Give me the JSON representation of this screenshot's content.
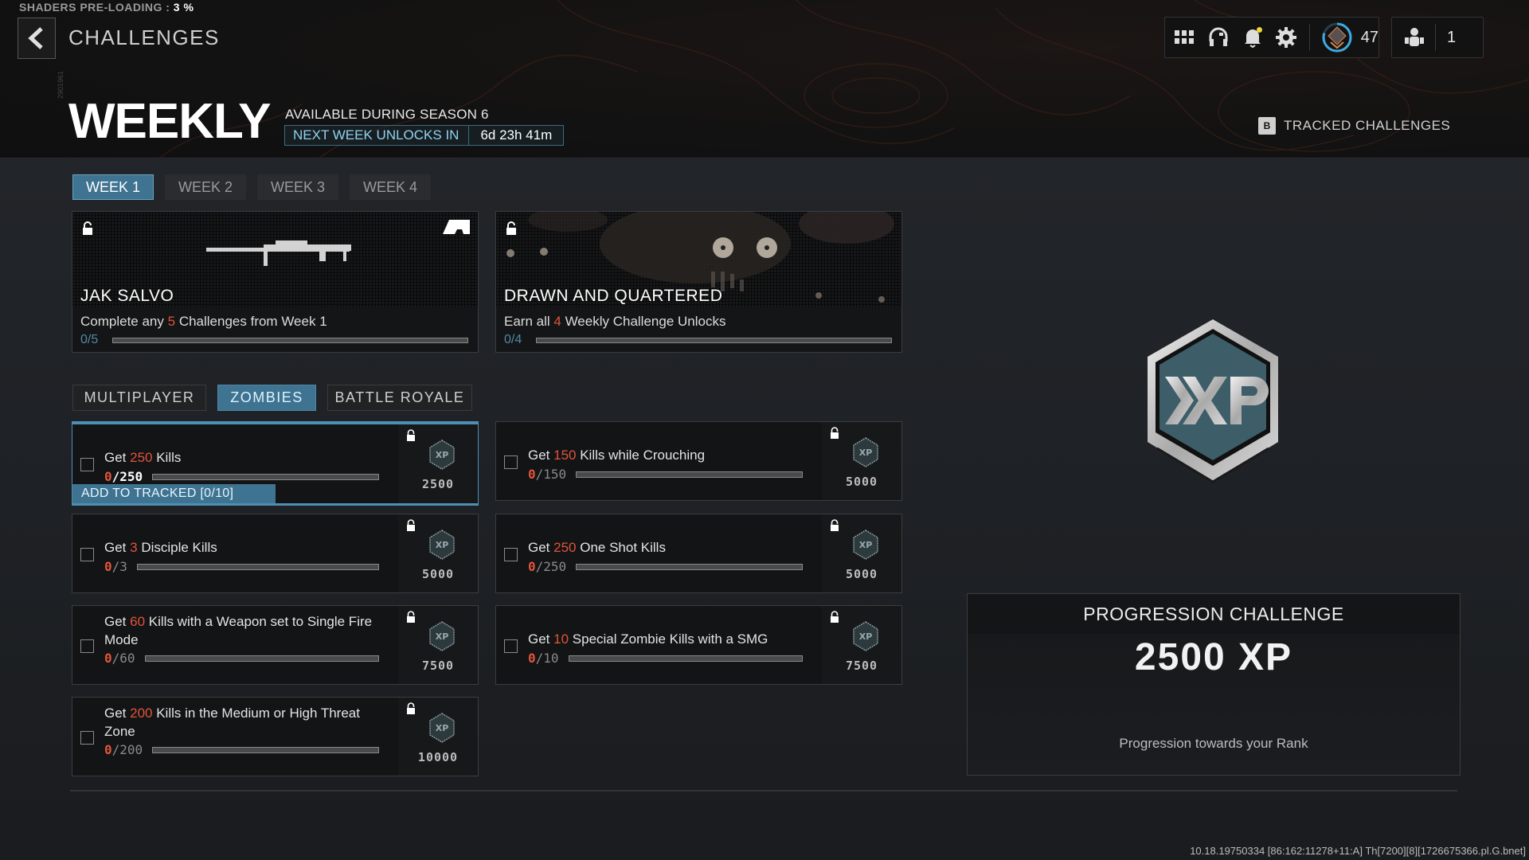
{
  "shaders": {
    "label": "SHADERS PRE-LOADING :",
    "value": "3 %"
  },
  "header": {
    "breadcrumb": "CHALLENGES",
    "title": "WEEKLY",
    "vertical_id": "2901961",
    "season": "AVAILABLE DURING SEASON 6",
    "unlock_label": "NEXT WEEK UNLOCKS IN",
    "unlock_time": "6d 23h 41m",
    "tracked_key": "B",
    "tracked_label": "TRACKED CHALLENGES"
  },
  "top_bar": {
    "icons": [
      "grid-menu-icon",
      "headset-icon",
      "notification-bell-icon",
      "settings-gear-icon",
      "rank-emblem-icon"
    ],
    "notification_dot_color": "#f0d53a",
    "rank_level": "47",
    "rank_progress": 0.8,
    "party_icon": "party-members-icon",
    "party_count": "1"
  },
  "week_tabs": [
    {
      "label": "WEEK 1",
      "active": true
    },
    {
      "label": "WEEK 2",
      "active": false
    },
    {
      "label": "WEEK 3",
      "active": false
    },
    {
      "label": "WEEK 4",
      "active": false
    }
  ],
  "unlock_cards": [
    {
      "title": "JAK SALVO",
      "desc_pre": "Complete any ",
      "desc_num": "5",
      "desc_post": " Challenges from Week 1",
      "progress_text": "0/5",
      "progress": 0,
      "art": "rifle-blueprint",
      "badge": "jak-brand-logo"
    },
    {
      "title": "DRAWN AND QUARTERED",
      "desc_pre": "Earn all ",
      "desc_num": "4",
      "desc_post": " Weekly Challenge Unlocks",
      "progress_text": "0/4",
      "progress": 0,
      "art": "zombie-face"
    }
  ],
  "mode_tabs": [
    {
      "label": "MULTIPLAYER",
      "active": false
    },
    {
      "label": "ZOMBIES",
      "active": true
    },
    {
      "label": "BATTLE ROYALE",
      "active": false
    }
  ],
  "challenges": [
    {
      "pre": "Get ",
      "num": "250",
      "post": " Kills",
      "current": "0",
      "total": "/250",
      "progress": 0,
      "xp": "2500",
      "selected": true
    },
    {
      "pre": "Get ",
      "num": "150",
      "post": " Kills while Crouching",
      "current": "0",
      "total": "/150",
      "progress": 0,
      "xp": "5000",
      "selected": false
    },
    {
      "pre": "Get ",
      "num": "3",
      "post": " Disciple Kills",
      "current": "0",
      "total": "/3",
      "progress": 0,
      "xp": "5000",
      "selected": false
    },
    {
      "pre": "Get ",
      "num": "250",
      "post": " One Shot Kills",
      "current": "0",
      "total": "/250",
      "progress": 0,
      "xp": "5000",
      "selected": false
    },
    {
      "pre": "Get ",
      "num": "60",
      "post": " Kills with a Weapon set to Single Fire Mode",
      "current": "0",
      "total": "/60",
      "progress": 0,
      "xp": "7500",
      "selected": false
    },
    {
      "pre": "Get ",
      "num": "10",
      "post": " Special Zombie Kills with a SMG",
      "current": "0",
      "total": "/10",
      "progress": 0,
      "xp": "7500",
      "selected": false
    },
    {
      "pre": "Get ",
      "num": "200",
      "post": " Kills in the Medium or High Threat Zone",
      "current": "0",
      "total": "/200",
      "progress": 0,
      "xp": "10000",
      "selected": false
    }
  ],
  "track_button": "ADD TO TRACKED [0/10]",
  "reward_panel": {
    "icon": "xp-emblem-icon",
    "title": "PROGRESSION CHALLENGE",
    "value": "2500 XP",
    "desc": "Progression towards your Rank"
  },
  "build_info": "10.18.19750334 [86:162:11278+11:A] Th[7200][8][1726675366.pl.G.bnet]",
  "colors": {
    "accent": "#3e7391",
    "highlight_number": "#e0543a",
    "unlock_text": "#8fd3f0"
  }
}
